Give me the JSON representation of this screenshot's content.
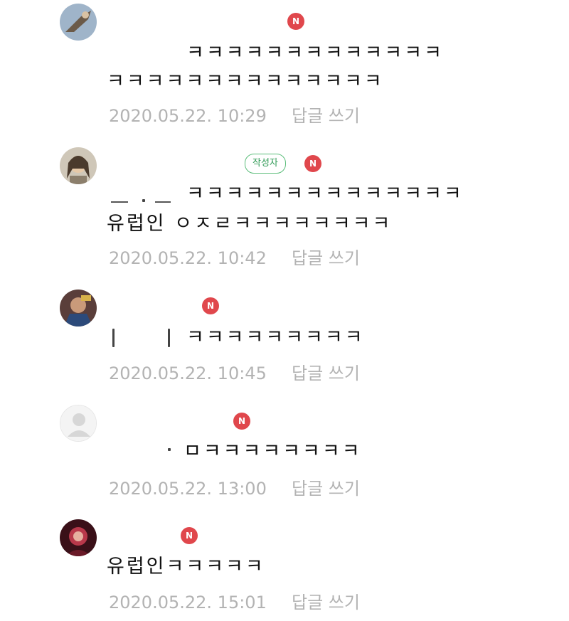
{
  "new_badge": "N",
  "author_badge": "작성자",
  "reply_label": "답글 쓰기",
  "comments": [
    {
      "lines": [
        "ㅋㅋㅋㅋㅋㅋㅋㅋㅋㅋㅋㅋㅋ",
        "ㅋㅋㅋㅋㅋㅋㅋㅋㅋㅋㅋㅋㅋㅋ"
      ],
      "date": "2020.05.22. 10:29"
    },
    {
      "lines": [
        "ㅋㅋㅋㅋㅋㅋㅋㅋㅋㅋㅋㅋㅋㅋ",
        "유럽인 ㅇㅈㄹㅋㅋㅋㅋㅋㅋㅋㅋ"
      ],
      "date": "2020.05.22. 10:42"
    },
    {
      "lines": [
        "ㅋㅋㅋㅋㅋㅋㅋㅋㅋ"
      ],
      "date": "2020.05.22. 10:45"
    },
    {
      "lines": [
        "ㅁㅋㅋㅋㅋㅋㅋㅋㅋ"
      ],
      "date": "2020.05.22. 13:00"
    },
    {
      "lines": [
        "유럽인ㅋㅋㅋㅋㅋ"
      ],
      "date": "2020.05.22. 15:01"
    }
  ]
}
